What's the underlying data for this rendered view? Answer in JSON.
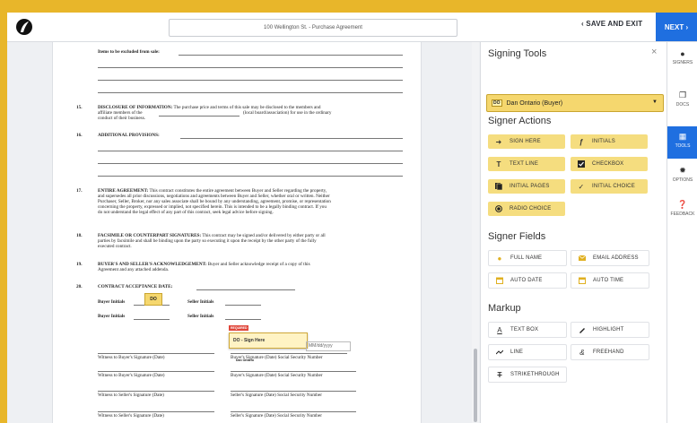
{
  "header": {
    "doc_title": "100 Wellington St. - Purchase Agreement",
    "save_exit": "SAVE AND EXIT",
    "next": "NEXT"
  },
  "document": {
    "excluded_label": "Items to be excluded from sale:",
    "s15_num": "15.",
    "s15_title": "DISCLOSURE OF INFORMATION:",
    "s15_text1": "The purchase price and terms of this sale may be disclosed to the members and",
    "s15_text2": "affiliate members of the",
    "s15_text2b": "(local board/association) for use in the ordinary",
    "s15_text3": "conduct of their business.",
    "s16_num": "16.",
    "s16_title": "ADDITIONAL PROVISIONS:",
    "s17_num": "17.",
    "s17_title": "ENTIRE AGREEMENT:",
    "s17_lines": [
      "This contract constitutes the entire agreement between Buyer and Seller regarding the property,",
      "and supersedes all prior discussions, negotiations and agreements between Buyer and Seller, whether oral or written. Neither",
      "Purchaser, Seller, Broker, nor any sales associate shall be bound by any understanding, agreement, promise, or representation",
      "concerning the property, expressed or implied, not specified herein. This is intended to be a legally binding contract. If you",
      "do not understand the legal effect of any part of this contract, seek legal advice before signing."
    ],
    "s18_num": "18.",
    "s18_title": "FACSIMILE OR COUNTERPART SIGNATURES:",
    "s18_lines": [
      "This contract may be signed and/or delivered by either party or all",
      "parties by facsimile and shall be binding upon the party so executing it upon the receipt by the other party of the fully",
      "executed contract."
    ],
    "s19_num": "19.",
    "s19_title": "BUYER'S AND SELLER'S ACKNOWLEDGEMENT:",
    "s19_lines": [
      "Buyer and Seller acknowledge receipt of a copy of this",
      "Agreement and any attached addenda."
    ],
    "s20_num": "20.",
    "s20_title": "CONTRACT ACCEPTANCE DATE:",
    "buyer_initials": "Buyer Initials",
    "seller_initials": "Seller Initials",
    "initials_chip": "DO",
    "sign_tag": "REQUIRED",
    "sign_here": "DO - Sign Here",
    "date_placeholder": "MM/dd/yyyy",
    "dan_ontario": "Dan Ontario",
    "witness_buyer": "Witness to Buyer's Signature (Date)",
    "buyer_sig": "Buyer's Signature (Date) Social Security Number",
    "witness_seller": "Witness to Seller's Signature (Date)",
    "seller_sig": "Seller's Signature (Date) Social Security Number"
  },
  "panel": {
    "title": "Signing Tools",
    "close": "×",
    "signer": "Dan Ontario (Buyer)",
    "signer_chip": "DO",
    "actions_heading": "Signer Actions",
    "actions": [
      {
        "label": "SIGN HERE",
        "icon": "arrow-right-icon"
      },
      {
        "label": "INITIALS",
        "icon": "initials-icon"
      },
      {
        "label": "TEXT LINE",
        "icon": "text-icon"
      },
      {
        "label": "CHECKBOX",
        "icon": "checkbox-icon"
      },
      {
        "label": "INITIAL PAGES",
        "icon": "pages-icon"
      },
      {
        "label": "INITIAL CHOICE",
        "icon": "check-icon"
      },
      {
        "label": "RADIO CHOICE",
        "icon": "radio-icon"
      }
    ],
    "fields_heading": "Signer Fields",
    "fields": [
      {
        "label": "FULL NAME",
        "icon": "person-icon"
      },
      {
        "label": "EMAIL ADDRESS",
        "icon": "email-icon"
      },
      {
        "label": "AUTO DATE",
        "icon": "calendar-icon"
      },
      {
        "label": "AUTO TIME",
        "icon": "clock-icon"
      }
    ],
    "markup_heading": "Markup",
    "markup": [
      {
        "label": "TEXT BOX",
        "icon": "textbox-icon"
      },
      {
        "label": "HIGHLIGHT",
        "icon": "highlighter-icon"
      },
      {
        "label": "LINE",
        "icon": "line-icon"
      },
      {
        "label": "FREEHAND",
        "icon": "freehand-icon"
      },
      {
        "label": "STRIKETHROUGH",
        "icon": "strikethrough-icon"
      }
    ]
  },
  "rail": [
    {
      "label": "SIGNERS",
      "icon": "person-icon"
    },
    {
      "label": "DOCS",
      "icon": "docs-icon"
    },
    {
      "label": "TOOLS",
      "icon": "tools-icon"
    },
    {
      "label": "OPTIONS",
      "icon": "gear-icon"
    },
    {
      "label": "FEEDBACK",
      "icon": "help-icon"
    }
  ],
  "colors": {
    "accent": "#1f6fe0",
    "frame": "#e8b62a",
    "tool_yellow": "#f5dd7f"
  }
}
